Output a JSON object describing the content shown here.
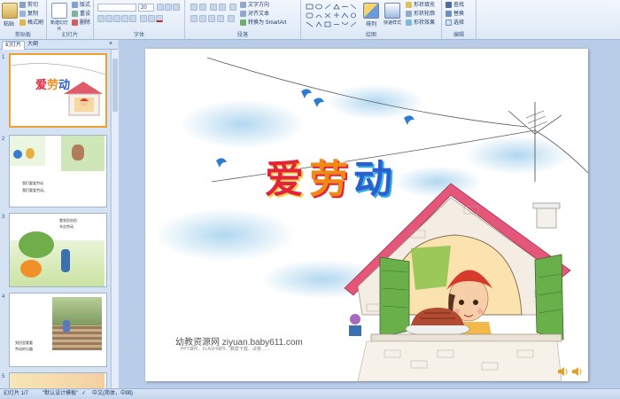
{
  "ribbon": {
    "clipboard": {
      "paste": "粘贴",
      "cut": "剪切",
      "copy": "复制",
      "format_painter": "格式刷",
      "group": "剪贴板"
    },
    "slides": {
      "new_slide": "新建幻灯片",
      "layout": "版式",
      "reset": "重设",
      "delete": "删除",
      "group": "幻灯片"
    },
    "font": {
      "size": "20",
      "group": "字体"
    },
    "paragraph": {
      "text_direction": "文字方向",
      "align_text": "对齐文本",
      "smartart": "转换为 SmartArt",
      "group": "段落"
    },
    "drawing": {
      "arrange": "排列",
      "quick_styles": "快速样式",
      "shape_fill": "形状填充",
      "shape_outline": "形状轮廓",
      "shape_effects": "形状效果",
      "group": "绘图"
    },
    "editing": {
      "find": "查找",
      "replace": "替换",
      "select": "选择",
      "group": "编辑"
    }
  },
  "panel": {
    "tab_slides": "幻灯片",
    "tab_outline": "大纲",
    "close": "×"
  },
  "thumbnails": [
    {
      "num": "1",
      "title": "爱劳动"
    },
    {
      "num": "2",
      "text": [
        "我们要爱劳动",
        "我们要爱劳动。"
      ]
    },
    {
      "num": "3",
      "text": [
        "看农民伯伯",
        "辛苦劳动"
      ]
    },
    {
      "num": "4",
      "text": [
        "到田里看看",
        "劳动的乐趣"
      ]
    },
    {
      "num": "5"
    }
  ],
  "slide": {
    "title_chars": [
      "爱",
      "劳",
      "动"
    ],
    "title_colors": [
      "#e2233a",
      "#f08a16",
      "#2a5fd0"
    ],
    "watermark": "幼教资源网 ziyuan.baby611.com",
    "watermark_sub": "PPT课件、FLASH课件、教案下载、试卷……"
  },
  "status": {
    "slide_count": "幻灯片 1/7",
    "theme": "\"默认设计模板\"",
    "language": "中文(简体，中国)"
  }
}
